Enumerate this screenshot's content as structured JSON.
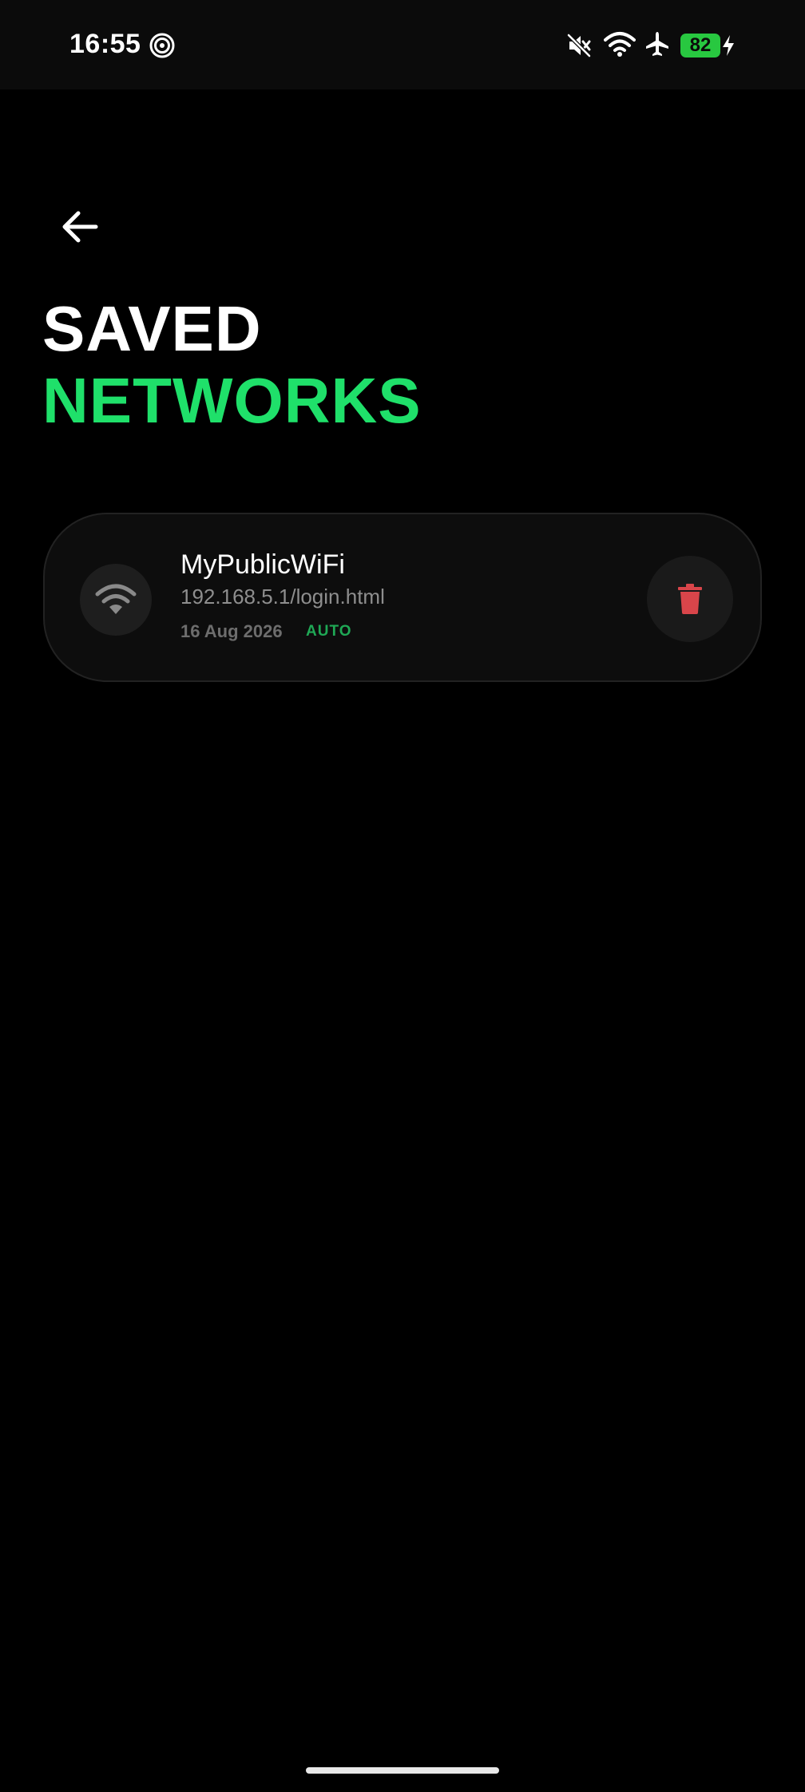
{
  "status_bar": {
    "time": "16:55",
    "battery_level": "82",
    "icons": [
      "spiral-icon",
      "mute-icon",
      "wifi-icon",
      "airplane-icon",
      "battery-icon",
      "charging-bolt-icon"
    ]
  },
  "header": {
    "back_icon": "arrow-left-icon",
    "title_line1": "SAVED",
    "title_line2": "NETWORKS"
  },
  "networks": [
    {
      "name": "MyPublicWiFi",
      "url": "192.168.5.1/login.html",
      "date": "16 Aug 2026",
      "badge": "AUTO",
      "icon": "wifi-icon",
      "action_icon": "trash-icon"
    }
  ],
  "colors": {
    "background": "#000000",
    "accent_green": "#1fe06a",
    "badge_green": "#1fa855",
    "delete_red": "#d9454a",
    "battery_green": "#28c840"
  }
}
